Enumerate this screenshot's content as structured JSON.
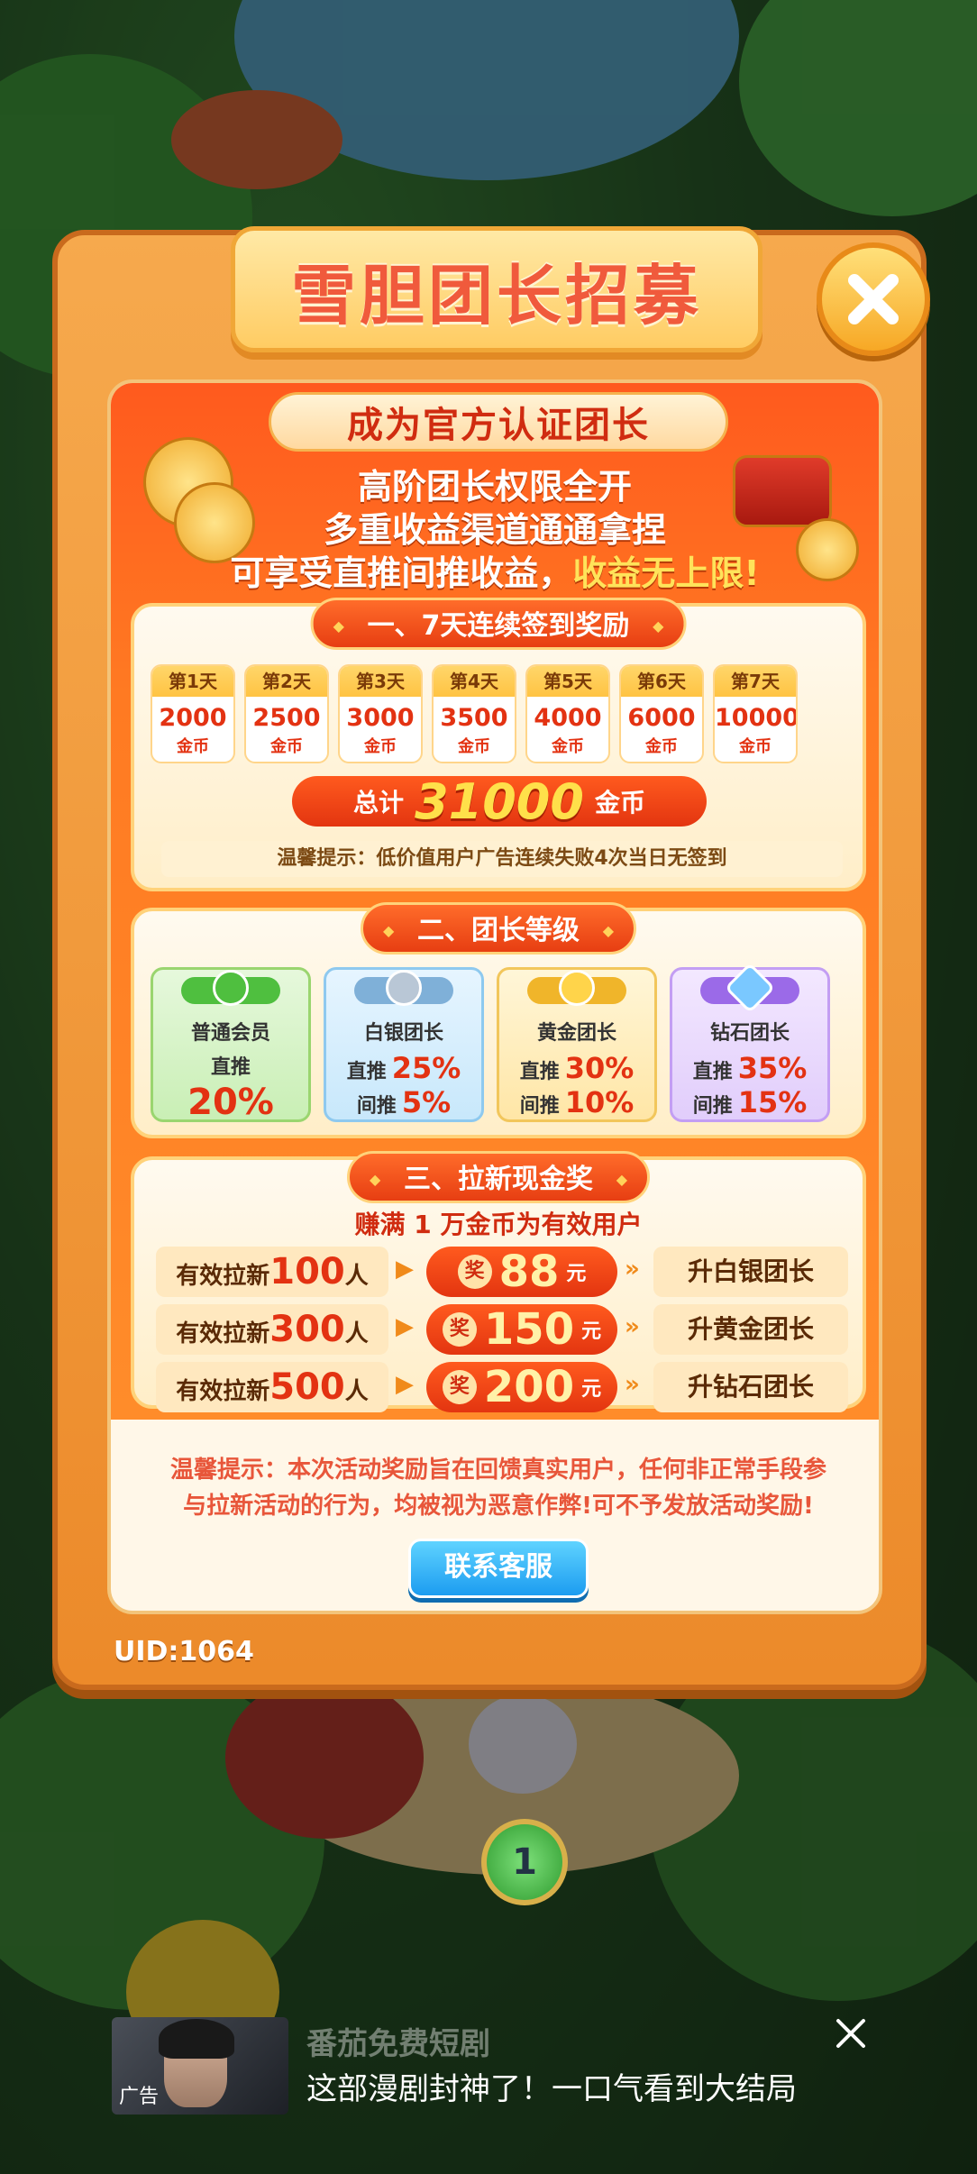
{
  "modal": {
    "title": "雪胆团长招募",
    "hero": {
      "ribbon": "成为官方认证团长",
      "line1": "高阶团长权限全开",
      "line2": "多重收益渠道通通拿捏",
      "line3_prefix": "可享受直推间推收益，",
      "line3_highlight": "收益无上限!"
    },
    "signin": {
      "title": "一、7天连续签到奖励",
      "days": [
        {
          "label": "第1天",
          "amount": "2000",
          "unit": "金币"
        },
        {
          "label": "第2天",
          "amount": "2500",
          "unit": "金币"
        },
        {
          "label": "第3天",
          "amount": "3000",
          "unit": "金币"
        },
        {
          "label": "第4天",
          "amount": "3500",
          "unit": "金币"
        },
        {
          "label": "第5天",
          "amount": "4000",
          "unit": "金币"
        },
        {
          "label": "第6天",
          "amount": "6000",
          "unit": "金币"
        },
        {
          "label": "第7天",
          "amount": "10000",
          "unit": "金币"
        }
      ],
      "total_label": "总计",
      "total_value": "31000",
      "total_unit": "金币",
      "tip": "温馨提示：低价值用户广告连续失败4次当日无签到"
    },
    "levels": {
      "title": "二、团长等级",
      "items": [
        {
          "name": "普通会员",
          "direct_label": "直推",
          "direct": "20%",
          "color": "#4fbf3f"
        },
        {
          "name": "白银团长",
          "direct_label": "直推",
          "direct": "25%",
          "indirect_label": "间推",
          "indirect": "5%",
          "color": "#7fb0d8"
        },
        {
          "name": "黄金团长",
          "direct_label": "直推",
          "direct": "30%",
          "indirect_label": "间推",
          "indirect": "10%",
          "color": "#f0b52a"
        },
        {
          "name": "钻石团长",
          "direct_label": "直推",
          "direct": "35%",
          "indirect_label": "间推",
          "indirect": "15%",
          "color": "#9b6ae8"
        }
      ]
    },
    "referral": {
      "title": "三、拉新现金奖",
      "subtitle": "赚满 1 万金币为有效用户",
      "rows": [
        {
          "prefix": "有效拉新",
          "count": "100",
          "suffix": "人",
          "badge": "奖",
          "amount": "88",
          "unit": "元",
          "result": "升白银团长"
        },
        {
          "prefix": "有效拉新",
          "count": "300",
          "suffix": "人",
          "badge": "奖",
          "amount": "150",
          "unit": "元",
          "result": "升黄金团长"
        },
        {
          "prefix": "有效拉新",
          "count": "500",
          "suffix": "人",
          "badge": "奖",
          "amount": "200",
          "unit": "元",
          "result": "升钻石团长"
        }
      ]
    },
    "warning_line1": "温馨提示：本次活动奖励旨在回馈真实用户，任何非正常手段参",
    "warning_line2": "与拉新活动的行为，均被视为恶意作弊!可不予发放活动奖励!",
    "service_button": "联系客服",
    "uid": "UID:1064"
  },
  "game": {
    "level_node": "1"
  },
  "ad": {
    "tag": "广告",
    "title": "番茄免费短剧",
    "description": "这部漫剧封神了！一口气看到大结局"
  },
  "colors": {
    "accent": "#e33212",
    "modal_orange": "#f6a94d",
    "button_blue": "#1c9cf0"
  }
}
